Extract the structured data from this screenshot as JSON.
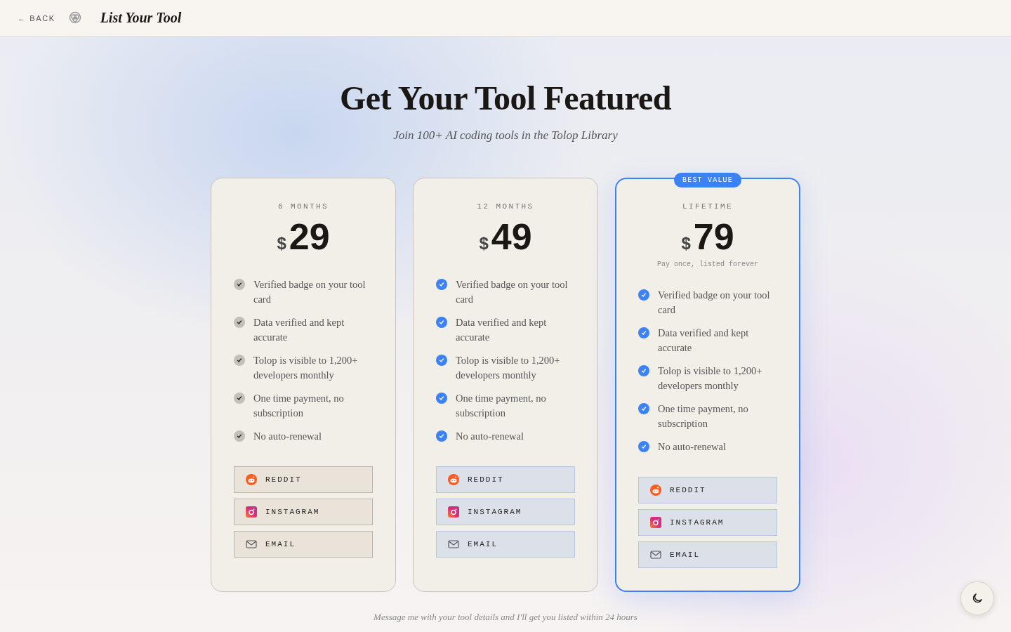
{
  "header": {
    "back": "← BACK",
    "title": "List Your Tool"
  },
  "hero": {
    "title": "Get Your Tool Featured",
    "subtitle": "Join 100+ AI coding tools in the Tolop Library"
  },
  "plans": [
    {
      "period": "6 MONTHS",
      "currency": "$",
      "price": "29",
      "accent": false,
      "featured": false,
      "features": [
        "Verified badge on your tool card",
        "Data verified and kept accurate",
        "Tolop is visible to 1,200+ developers monthly",
        "One time payment, no subscription",
        "No auto-renewal"
      ],
      "contacts": [
        {
          "kind": "reddit",
          "label": "REDDIT"
        },
        {
          "kind": "instagram",
          "label": "INSTAGRAM"
        },
        {
          "kind": "email",
          "label": "EMAIL"
        }
      ]
    },
    {
      "period": "12 MONTHS",
      "currency": "$",
      "price": "49",
      "accent": true,
      "featured": false,
      "features": [
        "Verified badge on your tool card",
        "Data verified and kept accurate",
        "Tolop is visible to 1,200+ developers monthly",
        "One time payment, no subscription",
        "No auto-renewal"
      ],
      "contacts": [
        {
          "kind": "reddit",
          "label": "REDDIT"
        },
        {
          "kind": "instagram",
          "label": "INSTAGRAM"
        },
        {
          "kind": "email",
          "label": "EMAIL"
        }
      ]
    },
    {
      "period": "LIFETIME",
      "currency": "$",
      "price": "79",
      "accent": true,
      "featured": true,
      "badge": "BEST VALUE",
      "note": "Pay once, listed forever",
      "features": [
        "Verified badge on your tool card",
        "Data verified and kept accurate",
        "Tolop is visible to 1,200+ developers monthly",
        "One time payment, no subscription",
        "No auto-renewal"
      ],
      "contacts": [
        {
          "kind": "reddit",
          "label": "REDDIT"
        },
        {
          "kind": "instagram",
          "label": "INSTAGRAM"
        },
        {
          "kind": "email",
          "label": "EMAIL"
        }
      ]
    }
  ],
  "footer_note": "Message me with your tool details and I'll get you listed within 24 hours"
}
